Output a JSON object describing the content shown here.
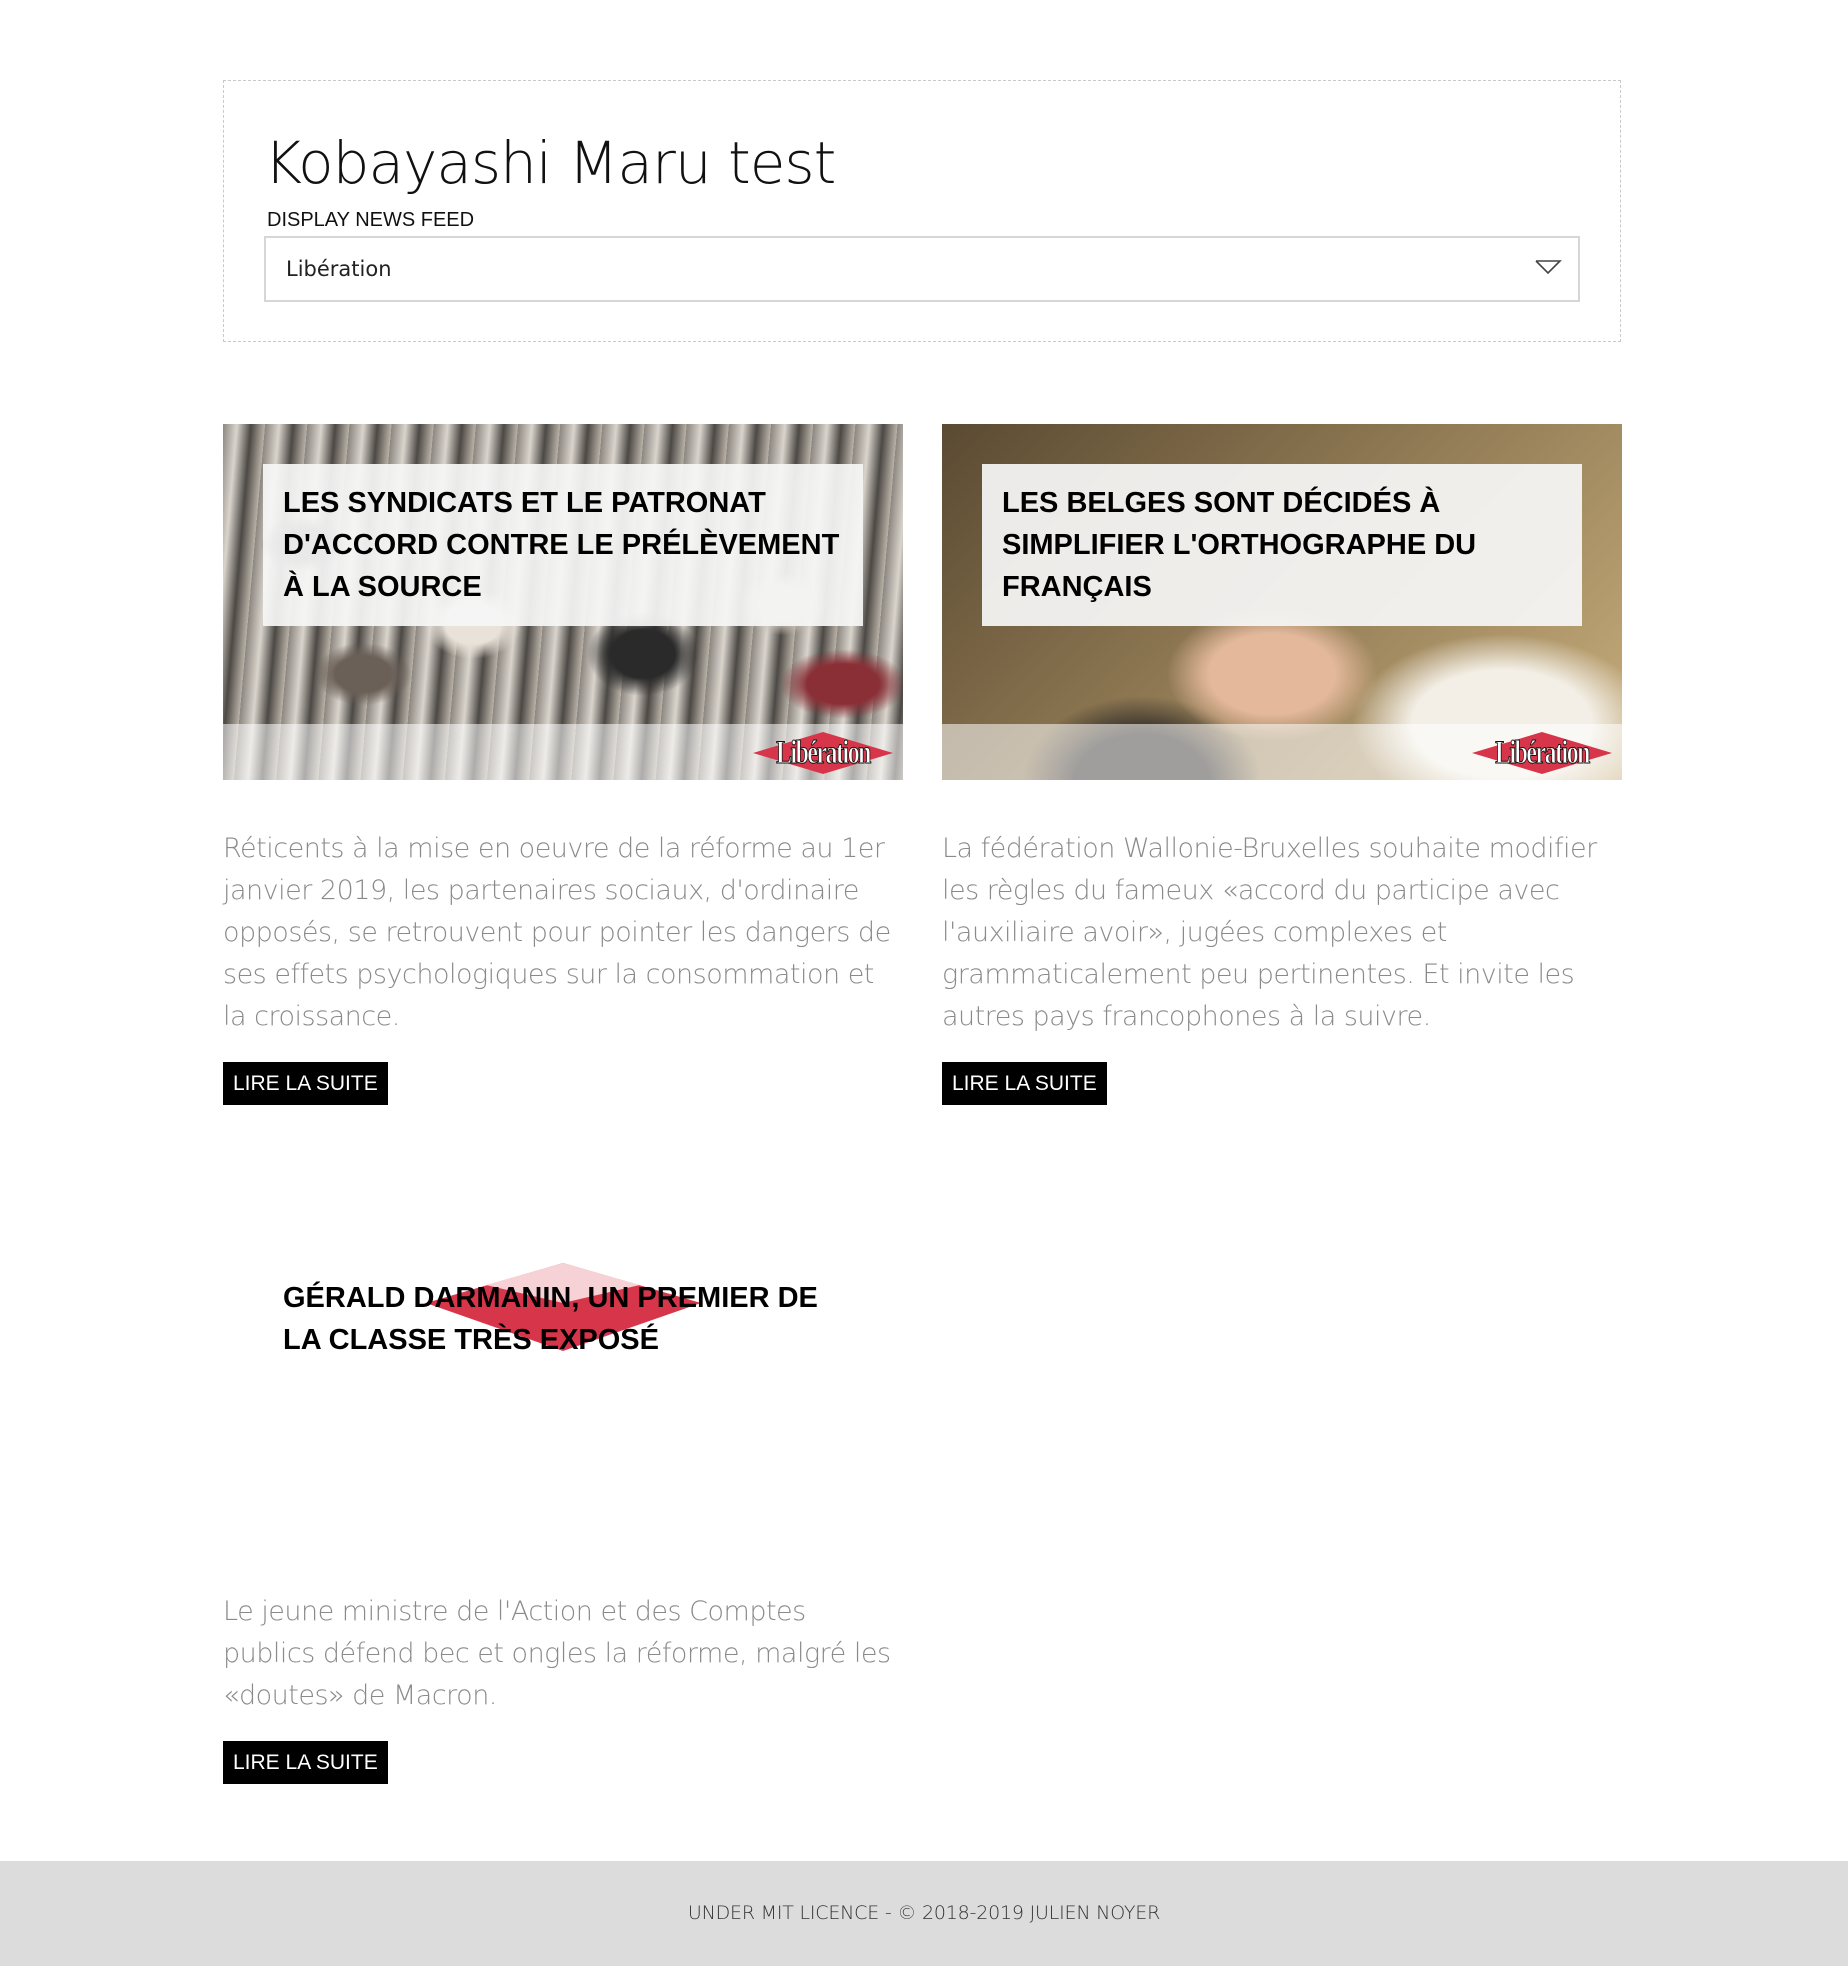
{
  "app": {
    "title": "Kobayashi Maru test"
  },
  "feed_selector": {
    "label": "DISPLAY NEWS FEED",
    "selected": "Libération",
    "icon": "chevron-down-icon"
  },
  "articles": [
    {
      "headline": "LES SYNDICATS ET LE PATRONAT D'ACCORD CONTRE LE PRÉLÈVEMENT À LA SOURCE",
      "excerpt": "Réticents à la mise en oeuvre de la réforme au 1er janvier 2019, les partenaires sociaux, d'ordinaire opposés, se retrouvent pour pointer les dangers de ses effets psychologiques sur la consommation et la croissance.",
      "read_more": "LIRE LA SUITE",
      "source_logo": "Libération"
    },
    {
      "headline": "LES BELGES SONT DÉCIDÉS À SIMPLIFIER L'ORTHOGRAPHE DU FRANÇAIS",
      "excerpt": "La fédération Wallonie-Bruxelles souhaite modifier les règles du fameux «accord du participe avec l'auxiliaire avoir», jugées complexes et grammaticalement peu pertinentes. Et invite les autres pays francophones à la suivre.",
      "read_more": "LIRE LA SUITE",
      "source_logo": "Libération"
    },
    {
      "headline": "GÉRALD DARMANIN, UN PREMIER DE LA CLASSE TRÈS EXPOSÉ",
      "excerpt": "Le jeune ministre de l'Action et des Comptes publics défend bec et ongles la réforme, malgré les «doutes» de Macron.",
      "read_more": "LIRE LA SUITE"
    }
  ],
  "footer": {
    "text": "UNDER MIT LICENCE - © 2018-2019 JULIEN NOYER"
  },
  "colors": {
    "brand_red": "#d7364a",
    "button_bg": "#000000",
    "footer_bg": "#dcdcdc",
    "excerpt_text": "#8a8a8a"
  }
}
